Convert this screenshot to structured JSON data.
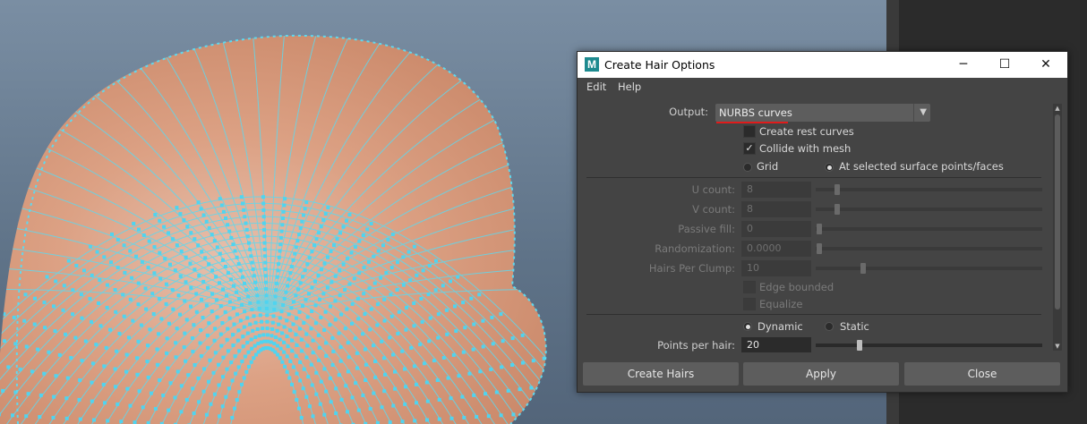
{
  "dialog": {
    "title": "Create Hair Options",
    "app_icon_letter": "M",
    "window_controls": {
      "minimize": "─",
      "maximize": "☐",
      "close": "✕"
    }
  },
  "menu": [
    "Edit",
    "Help"
  ],
  "output": {
    "label": "Output:",
    "value": "NURBS curves",
    "underline_color": "#e01b1b"
  },
  "checkboxes": {
    "create_rest_curves": {
      "label": "Create rest curves",
      "checked": false
    },
    "collide_with_mesh": {
      "label": "Collide with mesh",
      "checked": true,
      "mark": "✓"
    },
    "edge_bounded": {
      "label": "Edge bounded",
      "checked": false
    },
    "equalize": {
      "label": "Equalize",
      "checked": false
    }
  },
  "placement": {
    "grid_label": "Grid",
    "surface_label": "At selected surface points/faces",
    "selected": "surface"
  },
  "fields": {
    "u_count": {
      "label": "U count:",
      "value": "8",
      "slider_fraction": 0.1
    },
    "v_count": {
      "label": "V count:",
      "value": "8",
      "slider_fraction": 0.1
    },
    "passive_fill": {
      "label": "Passive fill:",
      "value": "0",
      "slider_fraction": 0.0
    },
    "randomization": {
      "label": "Randomization:",
      "value": "0.0000",
      "slider_fraction": 0.0
    },
    "hairs_per_clump": {
      "label": "Hairs Per Clump:",
      "value": "10",
      "slider_fraction": 0.2
    }
  },
  "mode": {
    "dynamic_label": "Dynamic",
    "static_label": "Static",
    "selected": "dynamic"
  },
  "points_per_hair": {
    "label": "Points per hair:",
    "value": "20",
    "slider_fraction": 0.2
  },
  "buttons": {
    "create": "Create Hairs",
    "apply": "Apply",
    "close": "Close"
  },
  "viewport": {
    "mesh_color": "#e0a98b",
    "wire_color": "#5fd8ee"
  }
}
